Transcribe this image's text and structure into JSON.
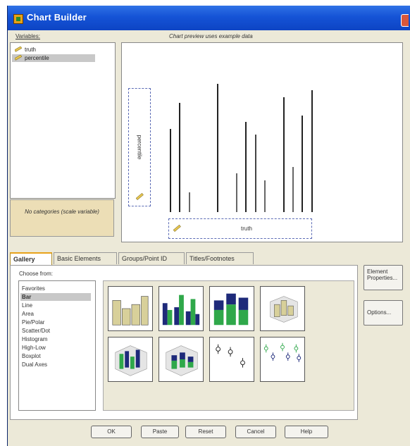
{
  "window": {
    "title": "Chart Builder"
  },
  "variables": {
    "label": "Variables:",
    "items": [
      {
        "name": "truth",
        "selected": false
      },
      {
        "name": "percentile",
        "selected": true
      }
    ],
    "no_categories": "No categories (scale variable)"
  },
  "preview": {
    "label": "Chart preview uses example data",
    "y_zone_label": "percentile",
    "x_zone_label": "truth"
  },
  "tabs": [
    "Gallery",
    "Basic Elements",
    "Groups/Point ID",
    "Titles/Footnotes"
  ],
  "gallery": {
    "choose_from_label": "Choose from:",
    "chart_types": [
      "Favorites",
      "Bar",
      "Line",
      "Area",
      "Pie/Polar",
      "Scatter/Dot",
      "Histogram",
      "High-Low",
      "Boxplot",
      "Dual Axes"
    ],
    "selected_type": "Bar",
    "thumbnail_icons": [
      "simple-bar-icon",
      "clustered-bar-icon",
      "stacked-bar-icon",
      "3d-bar-icon",
      "3d-clustered-bar-icon",
      "3d-stacked-bar-icon",
      "simple-error-bar-icon",
      "clustered-error-bar-icon"
    ]
  },
  "side_buttons": {
    "element_properties": "Element Properties...",
    "options": "Options..."
  },
  "buttons": {
    "ok": "OK",
    "paste": "Paste",
    "reset": "Reset",
    "cancel": "Cancel",
    "help": "Help"
  },
  "colors": {
    "bar_tan": "#d8d09a",
    "bar_navy": "#1e2a7a",
    "bar_green": "#2fa84a",
    "titlebar": "#1553d6"
  }
}
